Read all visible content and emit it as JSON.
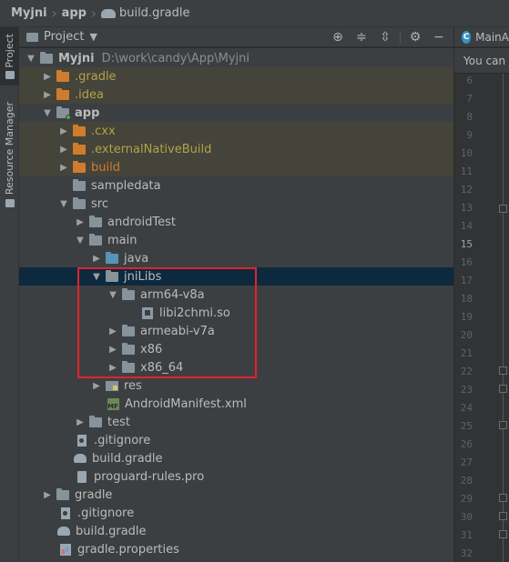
{
  "breadcrumb": {
    "root": "Myjni",
    "module": "app",
    "file": "build.gradle"
  },
  "stripe": {
    "project_tab": "Project",
    "resource_tab": "Resource Manager"
  },
  "panel": {
    "title": "Project"
  },
  "tree": {
    "root_name": "Myjni",
    "root_path": "D:\\work\\candy\\App\\Myjni",
    "gradle_dir": ".gradle",
    "idea_dir": ".idea",
    "app": "app",
    "cxx": ".cxx",
    "external_build": ".externalNativeBuild",
    "build_dir": "build",
    "sampledata": "sampledata",
    "src": "src",
    "android_test": "androidTest",
    "main": "main",
    "java": "java",
    "jni_libs": "jniLibs",
    "arm64": "arm64-v8a",
    "so_file": "libi2chmi.so",
    "armeabi": "armeabi-v7a",
    "x86": "x86",
    "x86_64": "x86_64",
    "res": "res",
    "manifest": "AndroidManifest.xml",
    "manifest_badge": "MF",
    "test": "test",
    "app_gitignore": ".gitignore",
    "app_build_gradle": "build.gradle",
    "proguard": "proguard-rules.pro",
    "gradle": "gradle",
    "root_gitignore": ".gitignore",
    "root_build_gradle": "build.gradle",
    "gradle_properties": "gradle.properties"
  },
  "editor": {
    "tab_label": "MainA",
    "tab_icon_letter": "C",
    "notice": "You can",
    "line_numbers": [
      "6",
      "7",
      "8",
      "9",
      "10",
      "11",
      "12",
      "13",
      "14",
      "15",
      "16",
      "17",
      "18",
      "19",
      "20",
      "21",
      "22",
      "23",
      "24",
      "25",
      "26",
      "27",
      "28",
      "29",
      "30",
      "31",
      "32"
    ],
    "current_line": "15"
  },
  "colors": {
    "highlight_box": "#e2222e",
    "selection": "#0d293e",
    "excluded_folder": "#d07c2e"
  }
}
